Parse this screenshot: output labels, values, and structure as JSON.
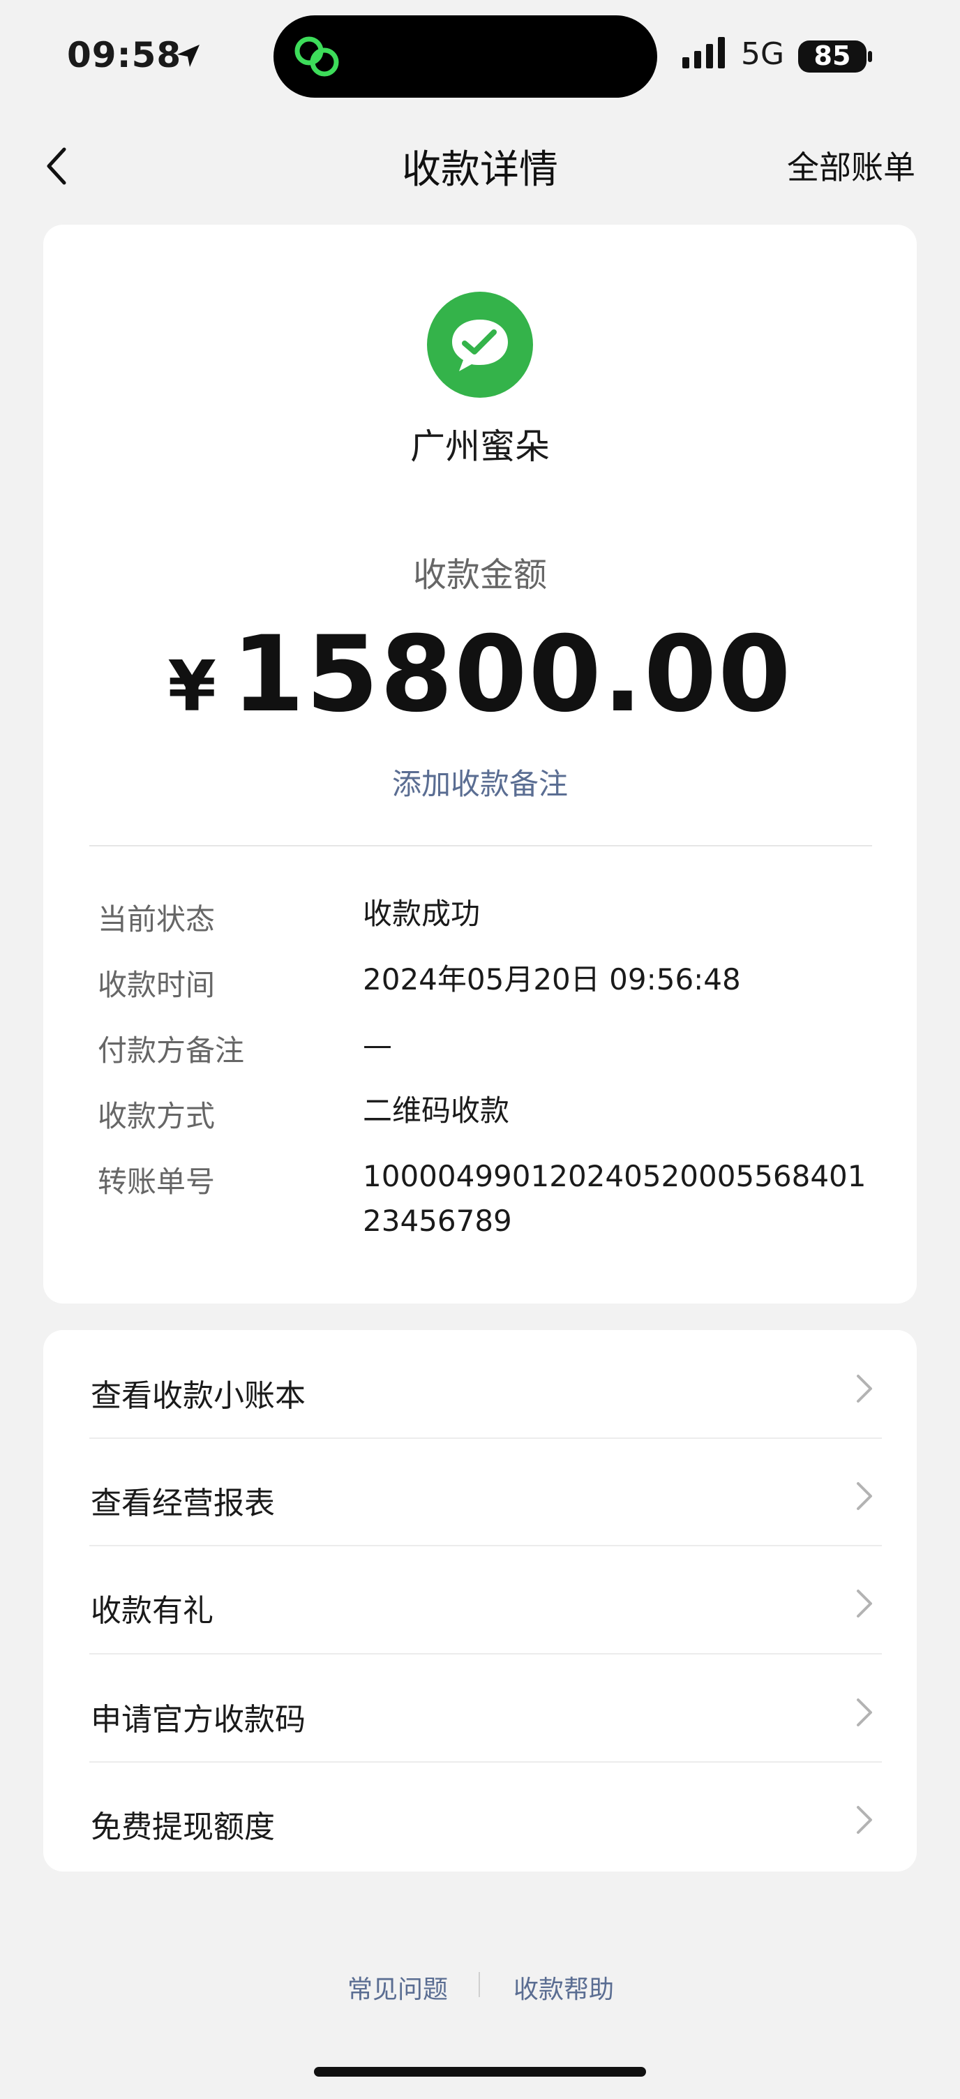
{
  "status_bar": {
    "time": "09:58",
    "network": "5G",
    "battery": "85"
  },
  "nav": {
    "title": "收款详情",
    "right_link": "全部账单"
  },
  "receipt": {
    "merchant": "广州蜜朵",
    "amount_label": "收款金额",
    "currency_symbol": "¥",
    "amount": "15800.00",
    "add_remark": "添加收款备注",
    "details": [
      {
        "label": "当前状态",
        "value": "收款成功"
      },
      {
        "label": "收款时间",
        "value": "2024年05月20日 09:56:48"
      },
      {
        "label": "付款方备注",
        "value": "—"
      },
      {
        "label": "收款方式",
        "value": "二维码收款"
      },
      {
        "label": "转账单号",
        "value": "100004990120240520005568401",
        "value_line2": "23456789"
      }
    ]
  },
  "menu": [
    {
      "label": "查看收款小账本"
    },
    {
      "label": "查看经营报表"
    },
    {
      "label": "收款有礼"
    },
    {
      "label": "申请官方收款码"
    },
    {
      "label": "免费提现额度"
    }
  ],
  "footer": {
    "faq": "常见问题",
    "help": "收款帮助"
  },
  "colors": {
    "logo_green": "#34b34a",
    "link_blue": "#5a6d92",
    "background": "#f2f2f2"
  }
}
